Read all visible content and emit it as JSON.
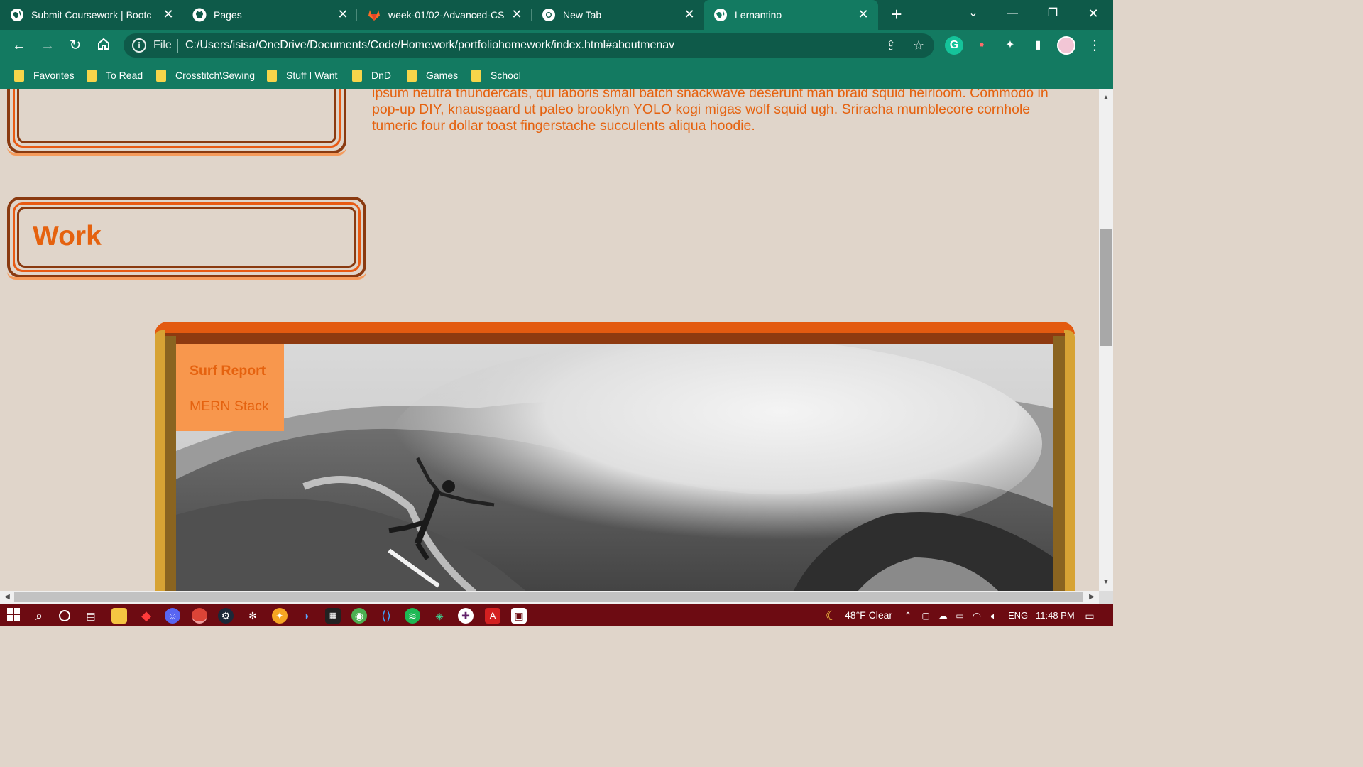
{
  "browser": {
    "tabs": [
      {
        "title": "Submit Coursework | Bootc",
        "icon": "globe-icon"
      },
      {
        "title": "Pages",
        "icon": "github-icon"
      },
      {
        "title": "week-01/02-Advanced-CSS",
        "icon": "gitlab-icon"
      },
      {
        "title": "New Tab",
        "icon": "chrome-icon"
      },
      {
        "title": "Lernantino",
        "icon": "globe-icon",
        "active": true
      }
    ],
    "address": {
      "scheme": "File",
      "url": "C:/Users/isisa/OneDrive/Documents/Code/Homework/portfoliohomework/index.html#aboutmenav"
    },
    "bookmarks": [
      "Favorites",
      "To Read",
      "Crosstitch\\Sewing",
      "Stuff I Want",
      "DnD",
      "Games",
      "School"
    ]
  },
  "page": {
    "about_paragraph": "ipsum neutra thundercats, qui laboris small batch snackwave deserunt man braid squid heirloom. Commodo in pop-up DIY, knausgaard ut paleo brooklyn YOLO kogi migas wolf squid ugh. Sriracha mumblecore cornhole tumeric four dollar toast fingerstache succulents aliqua hoodie.",
    "work_heading": "Work",
    "project_menu": [
      "Surf Report",
      "MERN Stack"
    ],
    "project_image": "black-and-white surfer riding a large breaking wave"
  },
  "taskbar": {
    "weather": "48°F  Clear",
    "language": "ENG",
    "time": "11:48 PM"
  },
  "colors": {
    "chrome_dark": "#0e5a49",
    "chrome": "#137a61",
    "page_bg": "#e0d5ca",
    "accent_orange": "#e5620f",
    "taskbar": "#6d0b12"
  }
}
